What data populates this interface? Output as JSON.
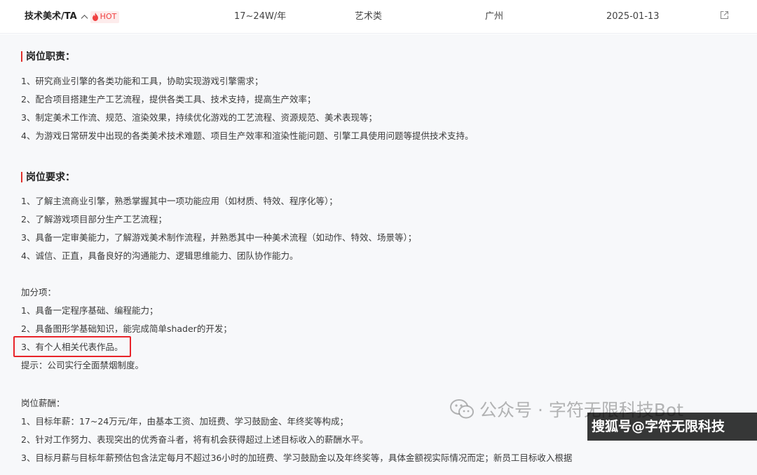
{
  "job_row": {
    "title": "技术美术/TA",
    "hot_label": "HOT",
    "salary": "17~24W/年",
    "category": "艺术类",
    "city": "广州",
    "date": "2025-01-13"
  },
  "duties": {
    "heading": "岗位职责：",
    "items": [
      "1、研究商业引擎的各类功能和工具，协助实现游戏引擎需求；",
      "2、配合项目搭建生产工艺流程，提供各类工具、技术支持，提高生产效率；",
      "3、制定美术工作流、规范、渲染效果，持续优化游戏的工艺流程、资源规范、美术表现等；",
      "4、为游戏日常研发中出现的各类美术技术难题、项目生产效率和渲染性能问题、引擎工具使用问题等提供技术支持。"
    ]
  },
  "requirements": {
    "heading": "岗位要求：",
    "items": [
      "1、了解主流商业引擎，熟悉掌握其中一项功能应用（如材质、特效、程序化等）；",
      "2、了解游戏项目部分生产工艺流程；",
      "3、具备一定审美能力，了解游戏美术制作流程，并熟悉其中一种美术流程（如动作、特效、场景等）；",
      "4、诚信、正直，具备良好的沟通能力、逻辑思维能力、团队协作能力。"
    ]
  },
  "bonus": {
    "heading": "加分项：",
    "items": [
      "1、具备一定程序基础、编程能力；",
      "2、具备图形学基础知识，能完成简单shader的开发；",
      "3、有个人相关代表作品。"
    ],
    "note": "提示：公司实行全面禁烟制度。"
  },
  "compensation": {
    "heading": "岗位薪酬：",
    "items": [
      "1、目标年薪：17~24万元/年，由基本工资、加班费、学习鼓励金、年终奖等构成；",
      "2、针对工作努力、表现突出的优秀奋斗者，将有机会获得超过上述目标收入的薪酬水平。",
      "3、目标月薪与目标年薪预估包含法定每月不超过36小时的加班费、学习鼓励金以及年终奖等，具体金额视实际情况而定；新员工目标收入根据"
    ]
  },
  "watermarks": {
    "wechat": "公众号 · 字符无限科技Bot",
    "sohu": "搜狐号@字符无限科技"
  },
  "colors": {
    "accent_red": "#e0302c",
    "hot_bg": "#fdecec",
    "highlight_border": "#e8242a"
  }
}
